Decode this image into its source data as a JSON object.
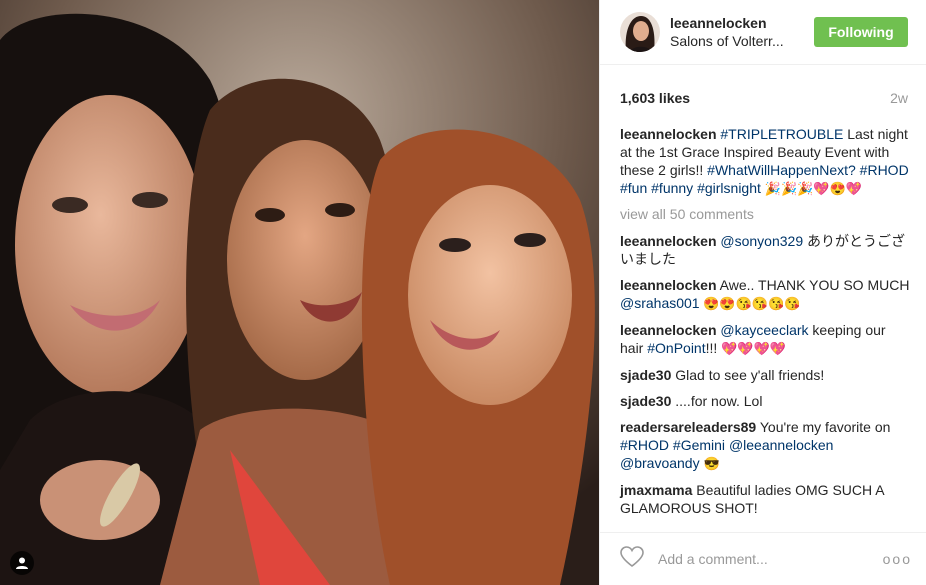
{
  "post": {
    "username": "leeannelocken",
    "location": "Salons of Volterr...",
    "follow_label": "Following",
    "likes": "1,603 likes",
    "time": "2w"
  },
  "caption": {
    "username": "leeannelocken",
    "hashtag1": "#TRIPLETROUBLE",
    "text": " Last night at the 1st Grace Inspired Beauty Event with these 2 girls!!",
    "hashtag2": "#WhatWillHappenNext?",
    "hashtag3": "#RHOD",
    "hashtag4": "#fun",
    "hashtag5": "#funny",
    "hashtag6": "#girlsnight",
    "emojis": "🎉🎉🎉💖😍💖"
  },
  "view_all": "view all 50 comments",
  "comments": [
    {
      "username": "leeannelocken",
      "mention": "@sonyon329",
      "text": " ありがとうございました"
    },
    {
      "username": "leeannelocken",
      "text1": " Awe.. THANK YOU SO MUCH ",
      "mention": "@srahas001",
      "emojis": " 😍😍😘😘😘😘"
    },
    {
      "username": "leeannelocken",
      "mention": "@kayceeclark",
      "text1": " keeping our hair ",
      "hashtag": "#OnPoint",
      "text2": "!!! ",
      "emojis": "💖💖💖💖"
    },
    {
      "username": "sjade30",
      "text": " Glad to see y'all friends!"
    },
    {
      "username": "sjade30",
      "text": " ....for now. Lol"
    },
    {
      "username": "readersareleaders89",
      "text1": " You're my favorite on ",
      "hashtag1": "#RHOD",
      "hashtag2": "#Gemini",
      "mention1": "@leeannelocken",
      "mention2": "@bravoandy",
      "emojis": "😎"
    },
    {
      "username": "jmaxmama",
      "text": " Beautiful ladies OMG SUCH A GLAMOROUS SHOT!"
    }
  ],
  "add_comment_placeholder": "Add a comment...",
  "more_options": "ooo",
  "icons": [
    "user-tag-icon",
    "heart-icon",
    "more-options-icon"
  ],
  "colors": {
    "follow_button": "#70c050",
    "link": "#003569",
    "muted": "#999999"
  }
}
